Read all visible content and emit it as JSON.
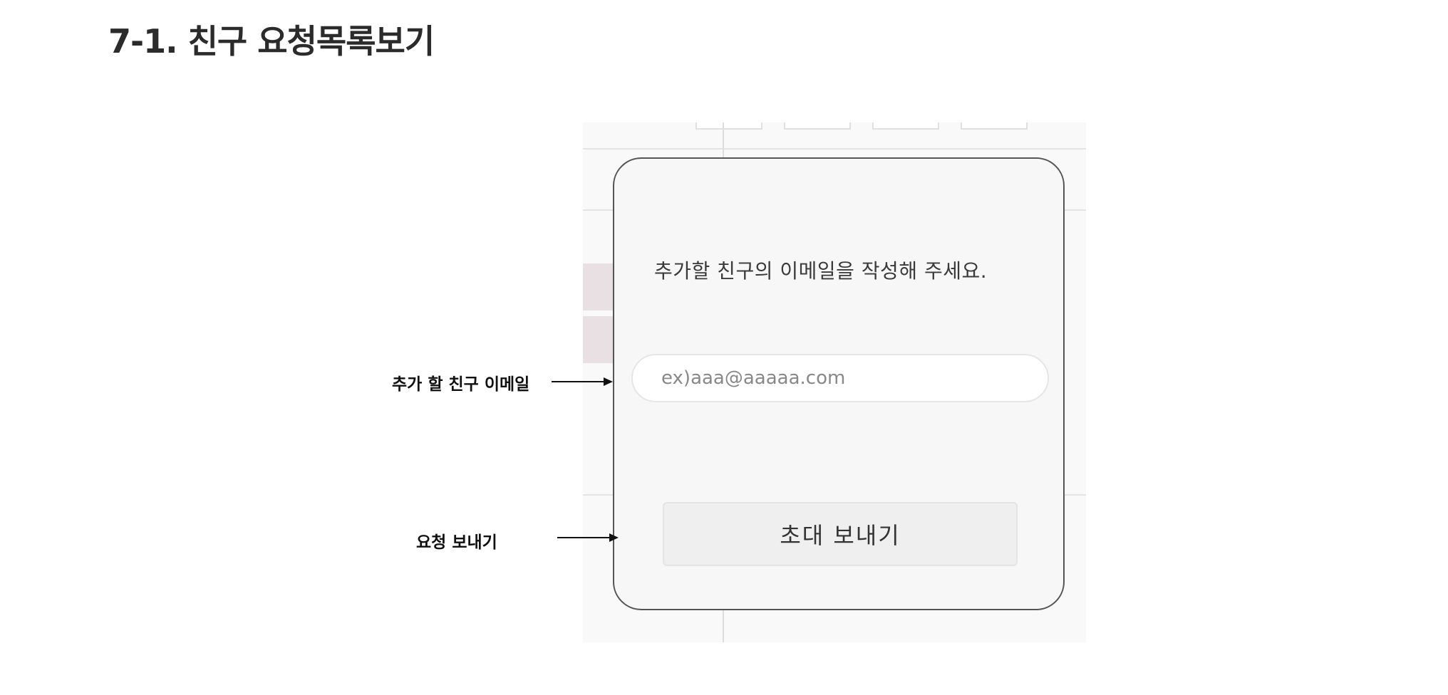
{
  "document": {
    "title": "7-1. 친구 요청목록보기"
  },
  "modal": {
    "message": "추가할 친구의 이메일을 작성해 주세요.",
    "email_input": {
      "value": "",
      "placeholder": "ex)aaa@aaaaa.com"
    },
    "invite_button_label": "초대 보내기"
  },
  "annotations": {
    "email_label": "추가 할 친구 이메일",
    "send_label": "요청 보내기"
  },
  "colors": {
    "modal_border": "#555555",
    "modal_background": "#f7f7f7",
    "button_background": "#efefef",
    "highlight_row": "#e8e0e2"
  }
}
